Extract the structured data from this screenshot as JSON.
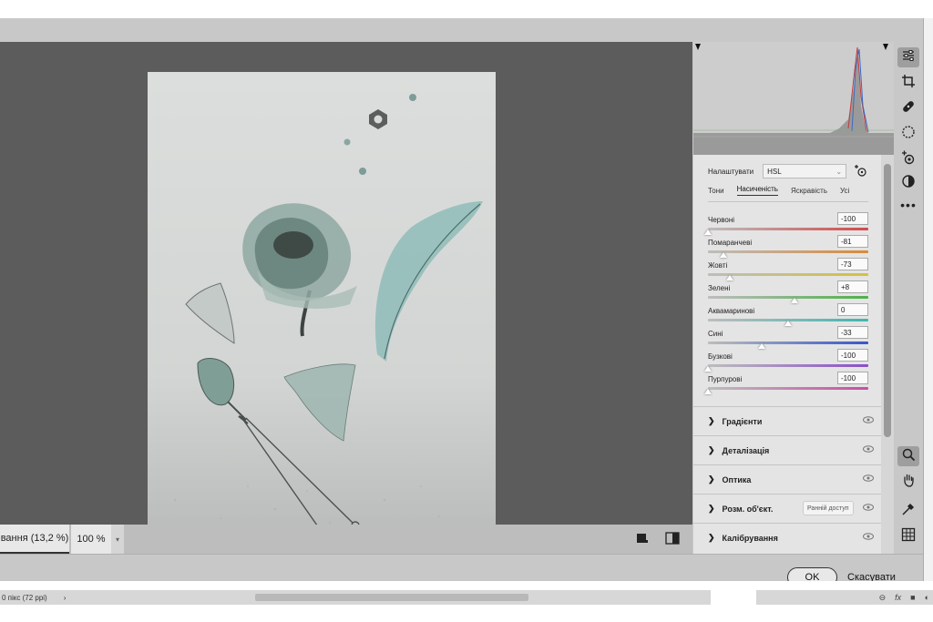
{
  "editor": {
    "zoom_fit_label": "вання (13,2 %)",
    "zoom_percent": "100 %",
    "status_text": "0 пікс (72 ppi)",
    "status_fx": "fx"
  },
  "panel": {
    "preset_label": "Налаштувати",
    "preset_value": "HSL",
    "tabs": [
      "Тони",
      "Насиченість",
      "Яскравість",
      "Усі"
    ],
    "active_tab": "Насиченість",
    "hsl": [
      {
        "label": "Червоні",
        "value": "-100",
        "level": -100
      },
      {
        "label": "Помаранчеві",
        "value": "-81",
        "level": -81
      },
      {
        "label": "Жовті",
        "value": "-73",
        "level": -73
      },
      {
        "label": "Зелені",
        "value": "+8",
        "level": 8
      },
      {
        "label": "Аквамаринові",
        "value": "0",
        "level": 0
      },
      {
        "label": "Сині",
        "value": "-33",
        "level": -33
      },
      {
        "label": "Бузкові",
        "value": "-100",
        "level": -100
      },
      {
        "label": "Пурпурові",
        "value": "-100",
        "level": -100
      }
    ],
    "sections": [
      {
        "label": "Градієнти"
      },
      {
        "label": "Деталізація"
      },
      {
        "label": "Оптика"
      },
      {
        "label": "Розм. об'єкт.",
        "badge": "Ранній доступ"
      },
      {
        "label": "Калібрування"
      }
    ]
  },
  "dialog": {
    "ok_label": "OK",
    "cancel_label": "Скасувати"
  },
  "colors": {
    "canvas_bg": "#5c5c5c",
    "panel_bg": "#e4e4e4",
    "track_red": "#d34a4a",
    "track_orange": "#d98a3a",
    "track_yellow": "#d4c23a",
    "track_green": "#4fb04a",
    "track_aqua": "#3fb7b0",
    "track_blue": "#3557c9",
    "track_purple": "#8a4fc8",
    "track_magenta": "#c84fa4"
  },
  "toolbar_icons": [
    "sliders-icon",
    "crop-icon",
    "healing-icon",
    "mask-icon",
    "redeye-icon",
    "presets-icon",
    "more-icon",
    "zoom-icon",
    "hand-icon",
    "eyedropper-icon",
    "grid-icon"
  ]
}
